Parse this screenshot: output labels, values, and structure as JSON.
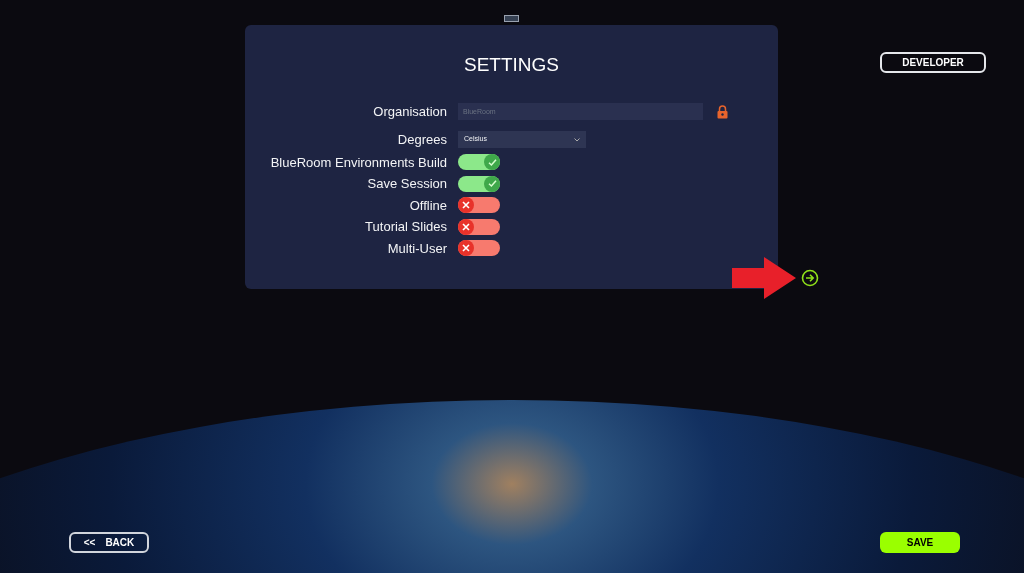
{
  "title": "SETTINGS",
  "developer_button": "DEVELOPER",
  "settings": [
    {
      "kind": "text-field",
      "label": "Organisation",
      "placeholder": "BlueRoom",
      "locked": true
    },
    {
      "kind": "dropdown",
      "label": "Degrees",
      "value": "Celsius"
    },
    {
      "kind": "toggle",
      "label": "BlueRoom Environments Build",
      "on": true
    },
    {
      "kind": "toggle",
      "label": "Save Session",
      "on": true
    },
    {
      "kind": "toggle",
      "label": "Offline",
      "on": false
    },
    {
      "kind": "toggle",
      "label": "Tutorial Slides",
      "on": false
    },
    {
      "kind": "toggle",
      "label": "Multi-User",
      "on": false
    }
  ],
  "back_button": {
    "icon": "<<",
    "label": "BACK"
  },
  "save_button": "SAVE"
}
